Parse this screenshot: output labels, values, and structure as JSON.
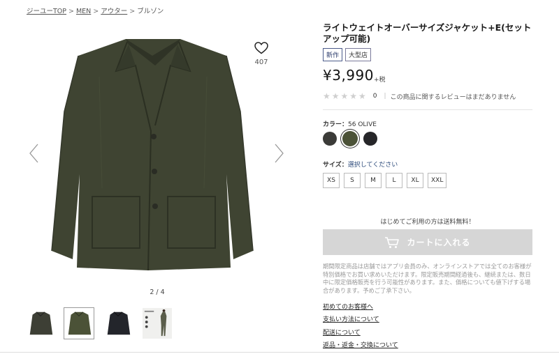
{
  "breadcrumb": {
    "items": [
      "ジーユーTOP",
      "MEN",
      "アウター",
      "ブルゾン"
    ],
    "separator": ">"
  },
  "product": {
    "title": "ライトウェイトオーバーサイズジャケット+E(セットアップ可能)",
    "badges": [
      "新作",
      "大型店"
    ],
    "price": "¥3,990",
    "tax_label": "+税",
    "rating_stars": "★★★★★",
    "review_count": "0",
    "review_divider": "|",
    "review_text": "この商品に関するレビューはまだありません",
    "favorite_count": "407",
    "image_pager": "2 / 4",
    "main_color": "#3f4432"
  },
  "color": {
    "label": "カラー：",
    "value": "56 OLIVE",
    "swatches": [
      {
        "name": "dark-gray",
        "hex": "#3b3b38"
      },
      {
        "name": "olive",
        "hex": "#4b5237"
      },
      {
        "name": "black",
        "hex": "#262629"
      }
    ],
    "selected_index": 1
  },
  "size": {
    "label": "サイズ：",
    "prompt": "選択してください",
    "options": [
      "XS",
      "S",
      "M",
      "L",
      "XL",
      "XXL"
    ]
  },
  "shipping_note": "はじめてご利用の方は送料無料！",
  "cart_button": "カートに入れる",
  "notice": "期間限定商品は店舗ではアプリ会員のみ、オンラインストアでは全てのお客様が特別価格でお買い求めいただけます。限定販売期間経過後も、継続または、数日中に限定価格販売を行う可能性があります。また、価格についても値下げする場合があります。予めご了承下さい。",
  "links": [
    "初めてのお客様へ",
    "支払い方法について",
    "配送について",
    "返品・返金・交換について"
  ]
}
